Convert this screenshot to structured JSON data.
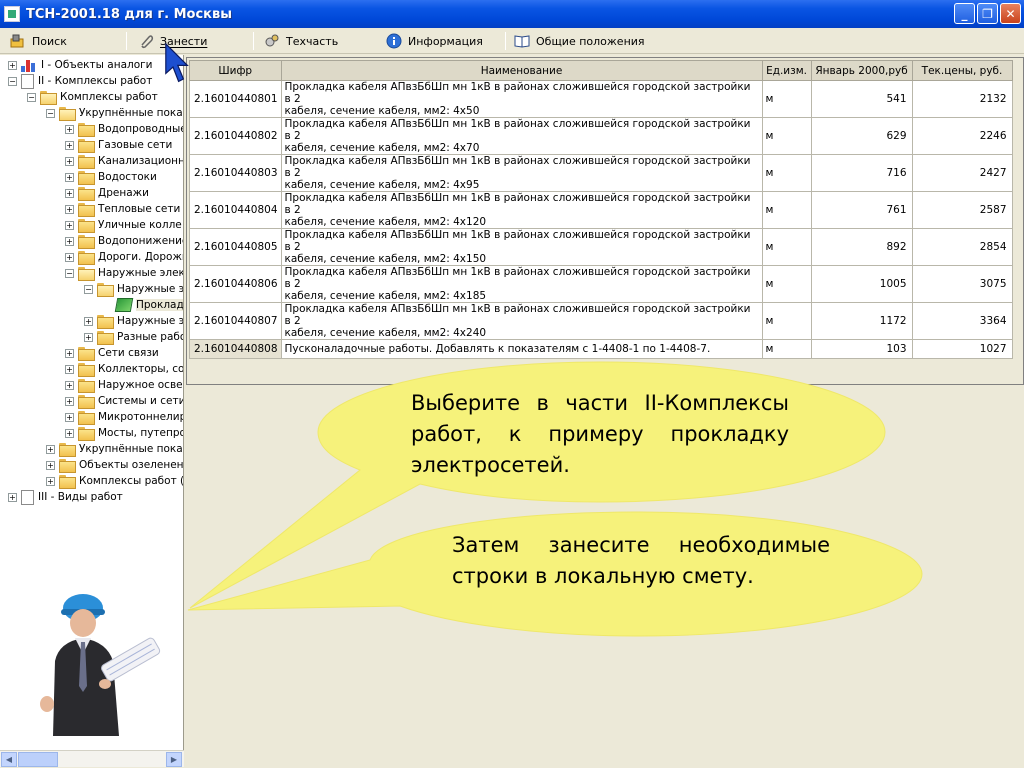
{
  "window": {
    "title": "ТСН-2001.18 для г. Москвы"
  },
  "colors": {
    "titlebar": "#0a55e3",
    "bubble": "#f6f27b",
    "panel": "#ece9d8"
  },
  "toolbar": {
    "search": "Поиск",
    "add": "Занести",
    "techpart": "Техчасть",
    "info": "Информация",
    "general": "Общие положения"
  },
  "tree": {
    "n1": "I - Объекты аналоги",
    "n2": "II - Комплексы работ",
    "n3": "Комплексы работ",
    "n4": "Укрупнённые показ",
    "n5": "Водопроводные",
    "n6": "Газовые сети",
    "n7": "Канализационн",
    "n8": "Водостоки",
    "n9": "Дренажи",
    "n10": "Тепловые сети",
    "n11": "Уличные колле",
    "n12": "Водопонижение",
    "n13": "Дороги. Дорожн",
    "n14": "Наружные элект",
    "n15": "Наружные э",
    "n16": "Проклад",
    "n17": "Наружные э",
    "n18": "Разные рабо",
    "n19": "Сети связи",
    "n20": "Коллекторы, со",
    "n21": "Наружное освещ",
    "n22": "Системы и сети",
    "n23": "Микротоннелир",
    "n24": "Мосты, путепро",
    "n25": "Укрупнённые показ",
    "n26": "Объекты озеленени",
    "n27": "Комплексы работ (г",
    "n28": "III - Виды работ"
  },
  "grid": {
    "headers": [
      "Шифр",
      "Наименование",
      "Ед.изм.",
      "Январь 2000,руб",
      "Тек.цены, руб."
    ],
    "rows": [
      {
        "code": "2.16010440801",
        "name1": "Прокладка кабеля АПвзБбШп мн 1кВ в районах сложившейся городской застройки в 2",
        "name2": "кабеля, сечение кабеля, мм2: 4x50",
        "unit": "м",
        "p2000": "541",
        "cur": "2132"
      },
      {
        "code": "2.16010440802",
        "name1": "Прокладка кабеля АПвзБбШп мн 1кВ в районах сложившейся городской застройки в 2",
        "name2": "кабеля, сечение кабеля, мм2: 4x70",
        "unit": "м",
        "p2000": "629",
        "cur": "2246"
      },
      {
        "code": "2.16010440803",
        "name1": "Прокладка кабеля АПвзБбШп мн 1кВ в районах сложившейся городской застройки в 2",
        "name2": "кабеля, сечение кабеля, мм2: 4x95",
        "unit": "м",
        "p2000": "716",
        "cur": "2427"
      },
      {
        "code": "2.16010440804",
        "name1": "Прокладка кабеля АПвзБбШп мн 1кВ в районах сложившейся городской застройки в 2",
        "name2": "кабеля, сечение кабеля, мм2: 4x120",
        "unit": "м",
        "p2000": "761",
        "cur": "2587"
      },
      {
        "code": "2.16010440805",
        "name1": "Прокладка кабеля АПвзБбШп мн 1кВ в районах сложившейся городской застройки в 2",
        "name2": "кабеля, сечение кабеля, мм2: 4x150",
        "unit": "м",
        "p2000": "892",
        "cur": "2854"
      },
      {
        "code": "2.16010440806",
        "name1": "Прокладка кабеля АПвзБбШп мн 1кВ в районах сложившейся городской застройки в 2",
        "name2": "кабеля, сечение кабеля, мм2: 4x185",
        "unit": "м",
        "p2000": "1005",
        "cur": "3075"
      },
      {
        "code": "2.16010440807",
        "name1": "Прокладка кабеля АПвзБбШп мн 1кВ в районах сложившейся городской застройки в 2",
        "name2": "кабеля, сечение кабеля, мм2: 4x240",
        "unit": "м",
        "p2000": "1172",
        "cur": "3364"
      },
      {
        "code": "2.16010440808",
        "name1": "Пусконаладочные работы. Добавлять к показателям с 1-4408-1 по 1-4408-7.",
        "name2": "",
        "unit": "м",
        "p2000": "103",
        "cur": "1027"
      }
    ]
  },
  "bubbles": {
    "b1": "Выберите в части II-Комплексы работ, к примеру прокладку электросетей.",
    "b2": "Затем занесите необходимые строки в локальную смету."
  }
}
